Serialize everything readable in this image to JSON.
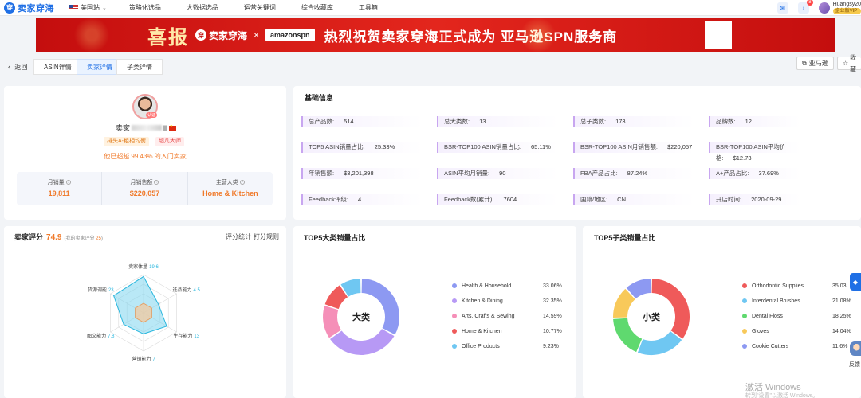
{
  "nav": {
    "logo_text": "卖家穿海",
    "site": "美国站",
    "menu": [
      "策略化选品",
      "大数据选品",
      "运营关键词",
      "综合收藏库",
      "工具箱"
    ],
    "notify_count": "8",
    "username": "Huangsy20",
    "vip_label": "企业版VIP"
  },
  "banner": {
    "xibao": "喜报",
    "brand": "卖家穿海",
    "x": "×",
    "amazon": "amazonspn",
    "slogan": "热烈祝贺卖家穿海正式成为 亚马逊SPN服务商"
  },
  "tabs": {
    "back": "返回",
    "items": [
      "ASIN详情",
      "卖家详情",
      "子类详情"
    ],
    "amazon_btn": "亚马逊",
    "fav_btn": "收藏"
  },
  "seller": {
    "name_prefix": "卖家",
    "name_suffix": "ll",
    "avatar_tag": "认证",
    "chip_top": "排头A-粗相均衡",
    "chip_expert": "超凡大师",
    "exceed_text": "他已超越 99.43% 的入门卖家",
    "stats": [
      {
        "label": "月销量",
        "value": "19,811"
      },
      {
        "label": "月销售额",
        "value": "$220,057"
      },
      {
        "label": "主营大类",
        "value": "Home & Kitchen"
      }
    ]
  },
  "basic_info": {
    "title": "基础信息",
    "rows": [
      [
        {
          "k": "总产品数:",
          "v": "514"
        },
        {
          "k": "总大类数:",
          "v": "13"
        },
        {
          "k": "总子类数:",
          "v": "173"
        },
        {
          "k": "品牌数:",
          "v": "12"
        }
      ],
      [
        {
          "k": "TOP5 ASIN销量占比:",
          "v": "25.33%"
        },
        {
          "k": "BSR-TOP100 ASIN销量占比:",
          "v": "65.11%"
        },
        {
          "k": "BSR-TOP100 ASIN月销售额:",
          "v": "$220,057"
        },
        {
          "k": "BSR-TOP100 ASIN平均价格:",
          "v": "$12.73"
        }
      ],
      [
        {
          "k": "年销售额:",
          "v": "$3,201,398"
        },
        {
          "k": "ASIN平均月销量:",
          "v": "90"
        },
        {
          "k": "FBA产品占比:",
          "v": "87.24%"
        },
        {
          "k": "A+产品占比:",
          "v": "37.69%"
        }
      ],
      [
        {
          "k": "Feedback评级:",
          "v": "4"
        },
        {
          "k": "Feedback数(累计):",
          "v": "7604"
        },
        {
          "k": "国籍/地区:",
          "v": "CN"
        },
        {
          "k": "开店时间:",
          "v": "2020-09-29"
        }
      ]
    ]
  },
  "score": {
    "title": "卖家评分",
    "value": "74.9",
    "sub_prefix": "(我的卖家评分",
    "sub_value": "25",
    "sub_suffix": ")",
    "link_stats": "评分统计",
    "link_rules": "打分规则"
  },
  "radar": {
    "axes": [
      {
        "label": "卖家体量",
        "value": "19.6",
        "level": 0.95
      },
      {
        "label": "选品能力",
        "value": "4.5",
        "level": 0.45
      },
      {
        "label": "生存能力",
        "value": "13",
        "level": 0.7
      },
      {
        "label": "营销能力",
        "value": "7",
        "level": 0.55
      },
      {
        "label": "图文能力",
        "value": "7.8",
        "level": 0.6
      },
      {
        "label": "货源调能",
        "value": "23",
        "level": 0.9
      }
    ],
    "colors": {
      "main_fill": "#7fd6ee",
      "main_stroke": "#2bb7de",
      "inner_fill": "#f6c89a",
      "inner_stroke": "#e89a5a"
    }
  },
  "top5_major": {
    "title": "TOP5大类销量占比",
    "center": "大类",
    "items": [
      {
        "name": "Health & Household",
        "pct": "33.06%",
        "value": 33.06,
        "color": "#8d99f2"
      },
      {
        "name": "Kitchen & Dining",
        "pct": "32.35%",
        "value": 32.35,
        "color": "#b799f5"
      },
      {
        "name": "Arts, Crafts & Sewing",
        "pct": "14.59%",
        "value": 14.59,
        "color": "#f58fb8"
      },
      {
        "name": "Home & Kitchen",
        "pct": "10.77%",
        "value": 10.77,
        "color": "#ef5a5a"
      },
      {
        "name": "Office Products",
        "pct": "9.23%",
        "value": 9.23,
        "color": "#6fc7f2"
      }
    ]
  },
  "top5_sub": {
    "title": "TOP5子类销量占比",
    "center": "小类",
    "items": [
      {
        "name": "Orthodontic Supplies",
        "pct": "35.03",
        "value": 35.03,
        "color": "#ef5a5a"
      },
      {
        "name": "Interdental Brushes",
        "pct": "21.08%",
        "value": 21.08,
        "color": "#6fc7f2"
      },
      {
        "name": "Dental Floss",
        "pct": "18.25%",
        "value": 18.25,
        "color": "#5fd96f"
      },
      {
        "name": "Gloves",
        "pct": "14.04%",
        "value": 14.04,
        "color": "#f8c95a"
      },
      {
        "name": "Cookie Cutters",
        "pct": "11.6%",
        "value": 11.6,
        "color": "#8d99f2"
      }
    ]
  },
  "side": {
    "feedback": "反馈"
  },
  "watermark": {
    "line1": "激活 Windows",
    "line2": "转到\"设置\"以激活 Windows。"
  }
}
